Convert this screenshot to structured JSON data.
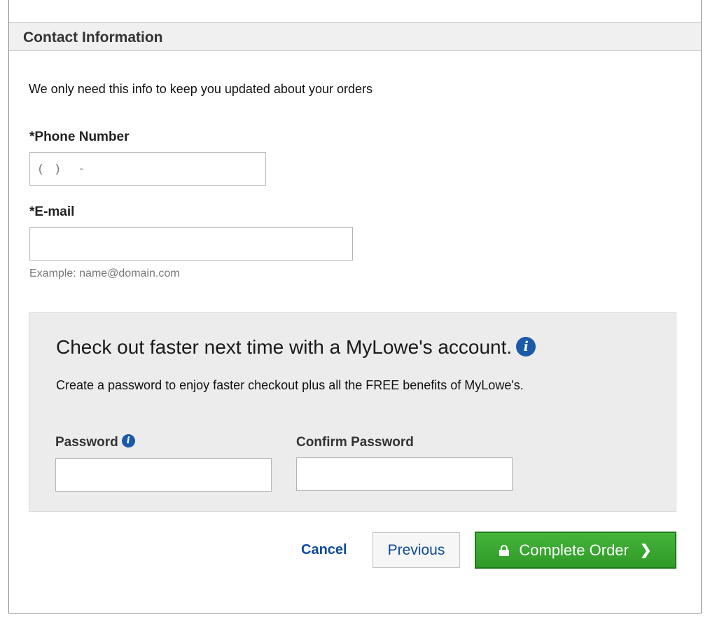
{
  "section": {
    "title": "Contact Information"
  },
  "intro_text": "We only need this info to keep you updated about your orders",
  "phone": {
    "label": "*Phone Number",
    "placeholder": "(    )      -"
  },
  "email": {
    "label": "*E-mail",
    "value": "",
    "hint": "Example: name@domain.com"
  },
  "account": {
    "title": "Check out faster next time with a MyLowe's account.",
    "description": "Create a password to enjoy faster checkout plus all the FREE benefits of MyLowe's.",
    "password_label": "Password",
    "confirm_label": "Confirm Password",
    "info_icon_glyph": "i"
  },
  "actions": {
    "cancel_label": "Cancel",
    "previous_label": "Previous",
    "complete_label": "Complete Order",
    "chevron_glyph": "❯"
  },
  "colors": {
    "link_blue": "#0d4a9a",
    "info_blue": "#1a5aa8",
    "complete_green": "#3aa830"
  }
}
